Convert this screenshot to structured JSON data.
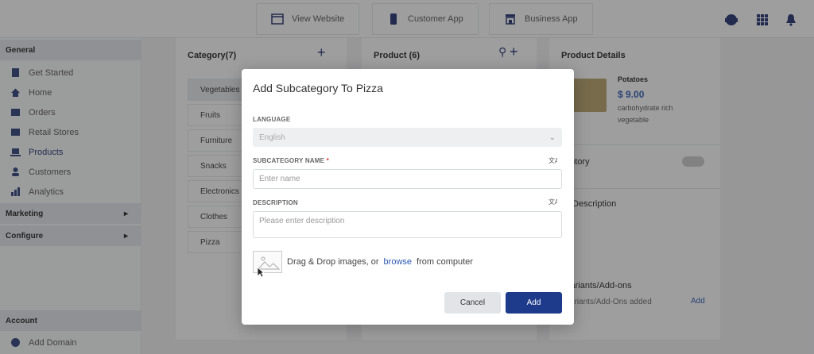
{
  "topbar": {
    "view_website": "View Website",
    "customer_app": "Customer App",
    "business_app": "Business App"
  },
  "sidebar": {
    "general": "General",
    "items": [
      "Get Started",
      "Home",
      "Orders",
      "Retail Stores",
      "Products",
      "Customers",
      "Analytics"
    ],
    "marketing": "Marketing",
    "configure": "Configure",
    "account": "Account",
    "add_domain": "Add Domain"
  },
  "category": {
    "title": "Category(7)",
    "items": [
      "Vegetables",
      "Fruits",
      "Furniture",
      "Snacks",
      "Electronics",
      "Clothes",
      "Pizza"
    ]
  },
  "product": {
    "title": "Product (6)"
  },
  "details": {
    "title": "Product Details",
    "name": "Potatoes",
    "price": "$ 9.00",
    "desc": "carbohydrate rich vegetable",
    "inventory": "entory",
    "long_desc": "g Description",
    "variants": "Variants/Add-ons",
    "variants_empty": "Variants/Add-Ons added",
    "add": "Add"
  },
  "modal": {
    "title": "Add Subcategory To Pizza",
    "language_label": "LANGUAGE",
    "language_value": "English",
    "name_label": "SUBCATEGORY NAME",
    "name_required": "*",
    "name_placeholder": "Enter name",
    "desc_label": "DESCRIPTION",
    "desc_placeholder": "Please enter description",
    "drop_prefix": "Drag & Drop images, or",
    "drop_link": "browse",
    "drop_suffix": "from computer",
    "cancel": "Cancel",
    "add": "Add"
  },
  "colors": {
    "primary": "#1e3a8a",
    "overlay": "rgba(40,40,40,0.45)"
  }
}
